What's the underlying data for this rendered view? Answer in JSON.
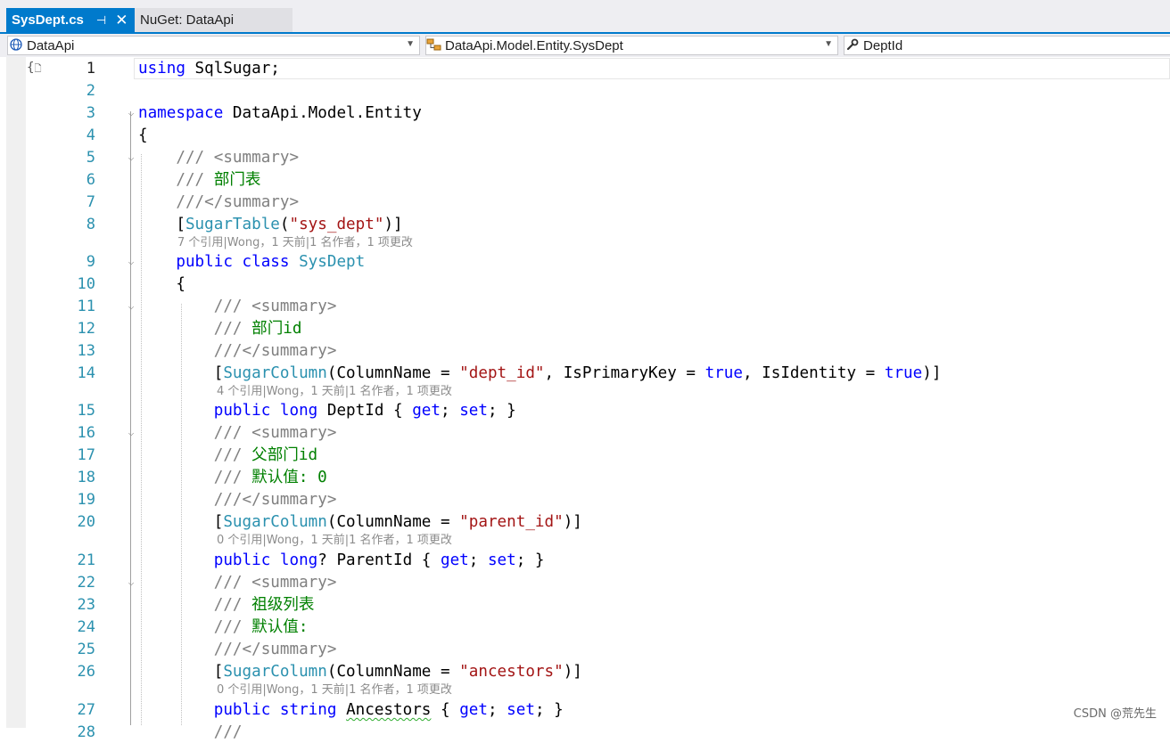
{
  "tabs": [
    {
      "label": "SysDept.cs",
      "active": true,
      "pin_glyph": "⊣",
      "close_glyph": "✕"
    },
    {
      "label": "NuGet: DataApi",
      "active": false
    }
  ],
  "navigation": {
    "project": "DataApi",
    "type": "DataApi.Model.Entity.SysDept",
    "member": "DeptId"
  },
  "editor": {
    "language": "csharp",
    "current_line": 1,
    "lines": [
      {
        "n": 1,
        "text": "using SqlSugar;"
      },
      {
        "n": 2,
        "text": ""
      },
      {
        "n": 3,
        "text": "namespace DataApi.Model.Entity"
      },
      {
        "n": 4,
        "text": "{"
      },
      {
        "n": 5,
        "text": "    /// <summary>"
      },
      {
        "n": 6,
        "text": "    /// 部门表"
      },
      {
        "n": 7,
        "text": "    ///</summary>"
      },
      {
        "n": 8,
        "text": "    [SugarTable(\"sys_dept\")]"
      },
      {
        "n": 9,
        "text": "    public class SysDept"
      },
      {
        "n": 10,
        "text": "    {"
      },
      {
        "n": 11,
        "text": "        /// <summary>"
      },
      {
        "n": 12,
        "text": "        /// 部门id"
      },
      {
        "n": 13,
        "text": "        ///</summary>"
      },
      {
        "n": 14,
        "text": "        [SugarColumn(ColumnName = \"dept_id\", IsPrimaryKey = true, IsIdentity = true)]"
      },
      {
        "n": 15,
        "text": "        public long DeptId { get; set; }"
      },
      {
        "n": 16,
        "text": "        /// <summary>"
      },
      {
        "n": 17,
        "text": "        /// 父部门id"
      },
      {
        "n": 18,
        "text": "        /// 默认值: 0"
      },
      {
        "n": 19,
        "text": "        ///</summary>"
      },
      {
        "n": 20,
        "text": "        [SugarColumn(ColumnName = \"parent_id\")]"
      },
      {
        "n": 21,
        "text": "        public long? ParentId { get; set; }"
      },
      {
        "n": 22,
        "text": "        /// <summary>"
      },
      {
        "n": 23,
        "text": "        /// 祖级列表"
      },
      {
        "n": 24,
        "text": "        /// 默认值:"
      },
      {
        "n": 25,
        "text": "        ///</summary>"
      },
      {
        "n": 26,
        "text": "        [SugarColumn(ColumnName = \"ancestors\")]"
      },
      {
        "n": 27,
        "text": "        public string Ancestors { get; set; }"
      },
      {
        "n": 28,
        "text": "        ///"
      }
    ],
    "codelens": {
      "class_sysdept": "7 个引用|Wong，1 天前|1 名作者，1 项更改",
      "prop_deptid": "4 个引用|Wong，1 天前|1 名作者，1 项更改",
      "prop_parentid": "0 个引用|Wong，1 天前|1 名作者，1 项更改",
      "prop_ancestors": "0 个引用|Wong，1 天前|1 名作者，1 项更改"
    }
  },
  "watermark": "CSDN @荒先生",
  "colors": {
    "accent": "#007acc",
    "keyword": "#0000ff",
    "type": "#2b91af",
    "string": "#a31515",
    "comment": "#008000",
    "xmldoc": "#808080",
    "line_number": "#2b91af"
  }
}
